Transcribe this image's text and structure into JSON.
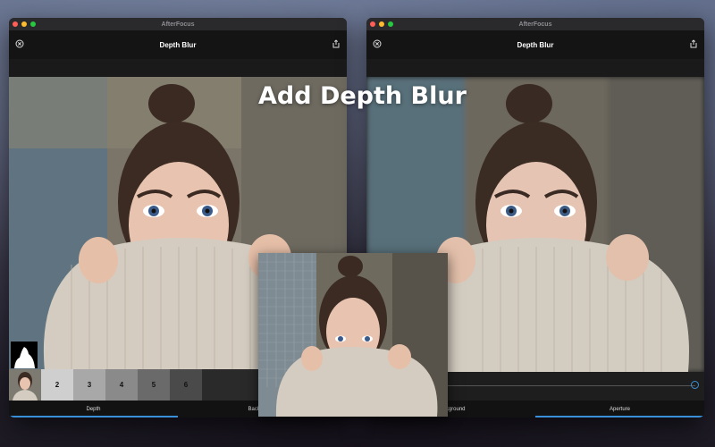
{
  "headline": "Add Depth Blur",
  "app_title": "AfterFocus",
  "left_window": {
    "title": "AfterFocus",
    "toolbar_title": "Depth Blur",
    "depth_levels": [
      {
        "label": "2",
        "color": "#cfcfcf"
      },
      {
        "label": "3",
        "color": "#a8a8a8"
      },
      {
        "label": "4",
        "color": "#8a8a8a"
      },
      {
        "label": "5",
        "color": "#6a6a6a"
      },
      {
        "label": "6",
        "color": "#4a4a4a"
      }
    ],
    "tabs": {
      "depth": "Depth",
      "background": "Background"
    },
    "active_tab": "depth"
  },
  "right_window": {
    "title": "AfterFocus",
    "toolbar_title": "Depth Blur",
    "tabs": {
      "background": "Background",
      "aperture": "Aperture"
    },
    "active_tab": "aperture",
    "aperture_slider_value": 0.02
  },
  "colors": {
    "accent": "#3a8fd9",
    "close": "#ff5f57",
    "minimize": "#febc2e",
    "zoom": "#28c840"
  },
  "icons": {
    "close": "close-circle-icon",
    "share": "share-icon",
    "mask": "person-mask-icon"
  }
}
